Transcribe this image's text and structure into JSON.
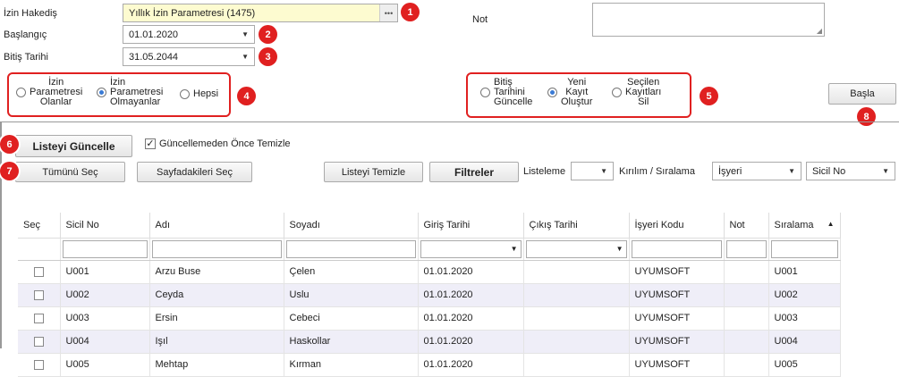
{
  "form": {
    "izin_hakedis_label": "İzin Hakediş",
    "izin_hakedis_value": "Yıllık İzin Parametresi (1475)",
    "baslangic_label": "Başlangıç",
    "baslangic_value": "01.01.2020",
    "bitis_label": "Bitiş Tarihi",
    "bitis_value": "31.05.2044",
    "not_label": "Not"
  },
  "badges": [
    "1",
    "2",
    "3",
    "4",
    "5",
    "6",
    "7",
    "8"
  ],
  "filter_radio": {
    "options": [
      {
        "label_lines": [
          "İzin",
          "Parametresi",
          "Olanlar"
        ],
        "selected": false
      },
      {
        "label_lines": [
          "İzin",
          "Parametresi",
          "Olmayanlar"
        ],
        "selected": true
      },
      {
        "label_lines": [
          "Hepsi"
        ],
        "selected": false
      }
    ]
  },
  "action_radio": {
    "options": [
      {
        "label_lines": [
          "Bitiş",
          "Tarihini",
          "Güncelle"
        ],
        "selected": false
      },
      {
        "label_lines": [
          "Yeni",
          "Kayıt",
          "Oluştur"
        ],
        "selected": true
      },
      {
        "label_lines": [
          "Seçilen",
          "Kayıtları",
          "Sil"
        ],
        "selected": false
      }
    ]
  },
  "buttons": {
    "basla": "Başla",
    "listeyi_guncelle": "Listeyi Güncelle",
    "tumunu_sec": "Tümünü Seç",
    "sayfadakileri_sec": "Sayfadakileri Seç",
    "listeyi_temizle": "Listeyi Temizle",
    "filtreler": "Filtreler"
  },
  "guncelleme_checkbox": {
    "label": "Güncellemeden Önce Temizle",
    "checked": true
  },
  "toolbar": {
    "listeleme_label": "Listeleme",
    "listeleme_value": "",
    "kirilim_label": "Kırılım / Sıralama",
    "kirilim_value": "İşyeri",
    "siralama_value": "Sicil No"
  },
  "table": {
    "columns": [
      "Seç",
      "Sicil No",
      "Adı",
      "Soyadı",
      "Giriş Tarihi",
      "Çıkış Tarihi",
      "İşyeri Kodu",
      "Not",
      "Sıralama"
    ],
    "sort_indicator": "▲",
    "rows": [
      {
        "sicil": "U001",
        "adi": "Arzu Buse",
        "soyadi": "Çelen",
        "giris": "01.01.2020",
        "cikis": "",
        "isyeri": "UYUMSOFT",
        "not": "",
        "siralama": "U001"
      },
      {
        "sicil": "U002",
        "adi": "Ceyda",
        "soyadi": "Uslu",
        "giris": "01.01.2020",
        "cikis": "",
        "isyeri": "UYUMSOFT",
        "not": "",
        "siralama": "U002"
      },
      {
        "sicil": "U003",
        "adi": "Ersin",
        "soyadi": "Cebeci",
        "giris": "01.01.2020",
        "cikis": "",
        "isyeri": "UYUMSOFT",
        "not": "",
        "siralama": "U003"
      },
      {
        "sicil": "U004",
        "adi": "Işıl",
        "soyadi": "Haskollar",
        "giris": "01.01.2020",
        "cikis": "",
        "isyeri": "UYUMSOFT",
        "not": "",
        "siralama": "U004"
      },
      {
        "sicil": "U005",
        "adi": "Mehtap",
        "soyadi": "Kırman",
        "giris": "01.01.2020",
        "cikis": "",
        "isyeri": "UYUMSOFT",
        "not": "",
        "siralama": "U005"
      }
    ]
  },
  "colors": {
    "badge": "#e02020",
    "highlight_field": "#fdfbd0",
    "alt_row": "#efeef8",
    "radio_on": "#3a7bd5"
  }
}
